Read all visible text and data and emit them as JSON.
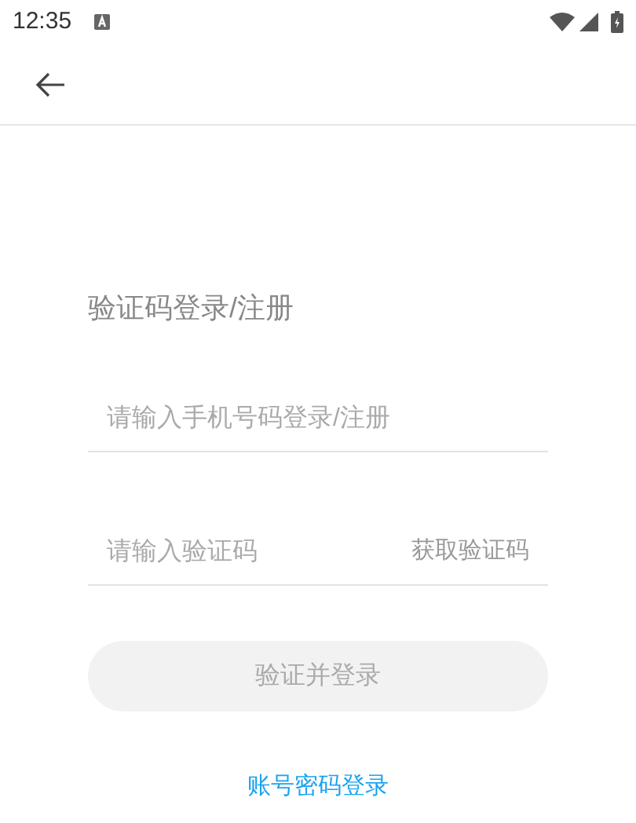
{
  "status_bar": {
    "time": "12:35"
  },
  "title": "验证码登录/注册",
  "phone_field": {
    "placeholder": "请输入手机号码登录/注册"
  },
  "code_field": {
    "placeholder": "请输入验证码",
    "action": "获取验证码"
  },
  "submit_button": {
    "label": "验证并登录",
    "disabled": true
  },
  "alt_login_link": "账号密码登录"
}
